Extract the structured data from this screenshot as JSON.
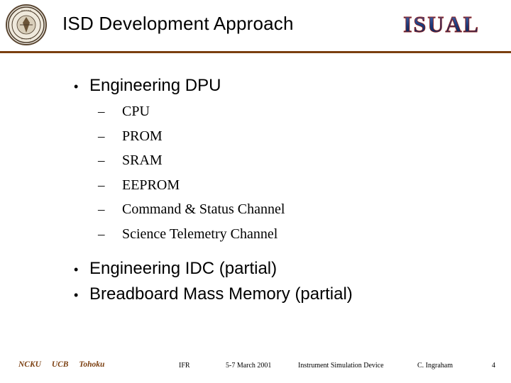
{
  "header": {
    "title": "ISD Development Approach",
    "seal_icon": "university-seal-icon",
    "logo_text": "ISUAL",
    "rule_color": "#7b3f10"
  },
  "content": {
    "bullets": [
      {
        "marker": "•",
        "text": "Engineering DPU",
        "sub_marker": "–",
        "sub_items": [
          "CPU",
          "PROM",
          "SRAM",
          "EEPROM",
          "Command & Status Channel",
          "Science Telemetry Channel"
        ]
      },
      {
        "marker": "•",
        "text": "Engineering IDC (partial)",
        "sub_items": []
      },
      {
        "marker": "•",
        "text": "Breadboard Mass Memory (partial)",
        "sub_items": []
      }
    ]
  },
  "footer": {
    "affiliations": [
      "NCKU",
      "UCB",
      "Tohoku"
    ],
    "review": "IFR",
    "date": "5-7 March 2001",
    "document": "Instrument Simulation Device",
    "author": "C. Ingraham",
    "page_number": "4",
    "accent_color": "#7b3f10"
  }
}
